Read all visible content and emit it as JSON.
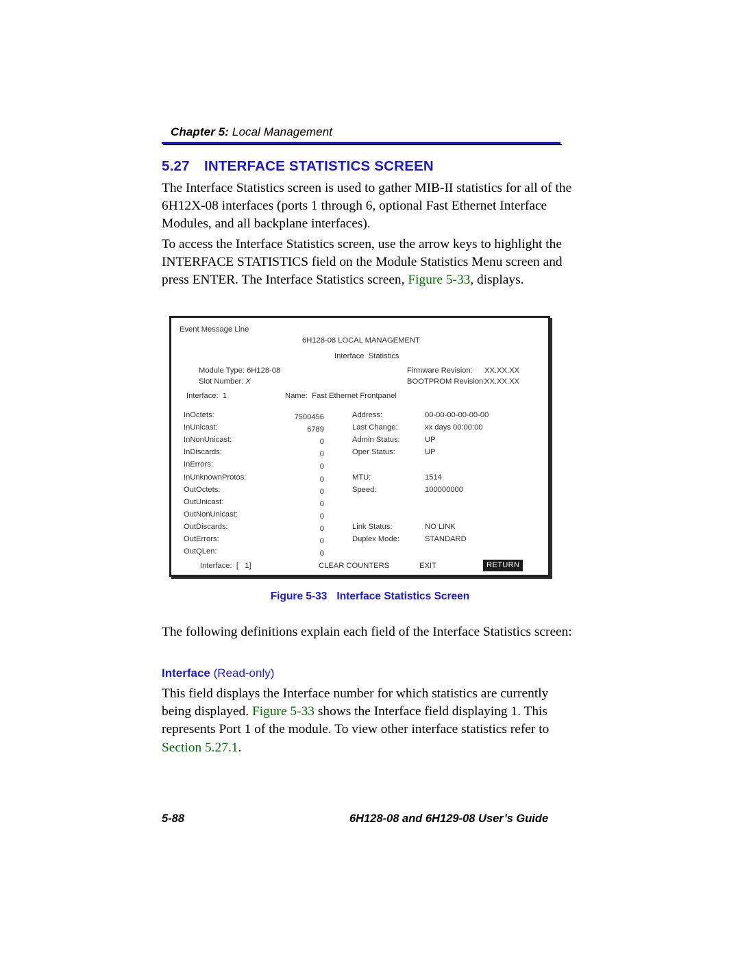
{
  "header": {
    "chapter_bold": "Chapter 5:",
    "chapter_title": " Local Management"
  },
  "section": {
    "number": "5.27",
    "title": "INTERFACE STATISTICS SCREEN"
  },
  "paragraphs": {
    "intro_1": "The Interface Statistics screen is used to gather MIB-II statistics for all of the 6H12X-08 interfaces (ports 1 through 6, optional Fast Ethernet Interface Modules, and all backplane interfaces).",
    "intro_2a": "To access the Interface Statistics screen, use the arrow keys to highlight the INTERFACE STATISTICS field on the Module Statistics Menu screen and press ENTER. The Interface Statistics screen, ",
    "intro_2_xref": "Figure 5-33",
    "intro_2b": ", displays.",
    "defs_intro": "The following definitions explain each field of the Interface Statistics screen:",
    "def_body_a": "This field displays the Interface number for which statistics are currently being displayed. ",
    "def_body_xref1": "Figure 5-33",
    "def_body_b": " shows the Interface field displaying 1. This represents Port 1 of the module. To view other interface statistics refer to ",
    "def_body_xref2": "Section 5.27.1",
    "def_body_c": "."
  },
  "definition": {
    "term": "Interface",
    "access": " (Read-only)"
  },
  "figure": {
    "caption_label": "Figure 5-33",
    "caption_title": "Interface Statistics Screen",
    "screen": {
      "event_message_line": "Event Message Line",
      "lm_title": "6H128-08 LOCAL MANAGEMENT",
      "screen_title": "Interface  Statistics",
      "module_type": "Module Type: 6H128-08",
      "slot_number_label": "Slot Number: ",
      "slot_number_value": "X",
      "firmware_revision_label": "Firmware Revision:",
      "firmware_revision_value": "XX.XX.XX",
      "bootprom_revision_label": "BOOTPROM Revision:",
      "bootprom_revision_value": "XX.XX.XX",
      "interface_label": "Interface:  1",
      "name_label": "Name:  Fast Ethernet Frontpanel",
      "left_stats": [
        {
          "label": "InOctets:",
          "value": "7500456"
        },
        {
          "label": "InUnicast:",
          "value": "6789"
        },
        {
          "label": "InNonUnicast:",
          "value": "0"
        },
        {
          "label": "InDiscards:",
          "value": "0"
        },
        {
          "label": "InErrors:",
          "value": "0"
        },
        {
          "label": "InUnknownProtos:",
          "value": "0"
        },
        {
          "label": "OutOctets:",
          "value": "0"
        },
        {
          "label": "OutUnicast:",
          "value": "0"
        },
        {
          "label": "OutNonUnicast:",
          "value": "0"
        },
        {
          "label": "OutDiscards:",
          "value": "0"
        },
        {
          "label": "OutErrors:",
          "value": "0"
        },
        {
          "label": "OutQLen:",
          "value": "0"
        }
      ],
      "right_stats": [
        {
          "label": "Address:",
          "value": "00-00-00-00-00-00",
          "row": 0
        },
        {
          "label": "Last Change:",
          "value": "xx days 00:00:00",
          "row": 1
        },
        {
          "label": "Admin Status:",
          "value": "UP",
          "row": 2
        },
        {
          "label": "Oper Status:",
          "value": "UP",
          "row": 3
        },
        {
          "label": "MTU:",
          "value": "1514",
          "row": 5
        },
        {
          "label": "Speed:",
          "value": "100000000",
          "row": 6
        },
        {
          "label": "Link Status:",
          "value": "NO LINK",
          "row": 9
        },
        {
          "label": "Duplex Mode:",
          "value": "STANDARD",
          "row": 10
        }
      ],
      "footer_interface": "Interface:  [   1]",
      "footer_clear_counters": "CLEAR COUNTERS",
      "footer_exit": "EXIT",
      "footer_return": "RETURN"
    }
  },
  "footer": {
    "page_number": "5-88",
    "guide_title": "6H128-08 and 6H129-08 User’s Guide"
  },
  "colors": {
    "heading_blue": "#1a18e0",
    "xref_green": "#007000",
    "rule_blue": "#1a18e0",
    "highlight_bg": "#1b1b1b"
  }
}
